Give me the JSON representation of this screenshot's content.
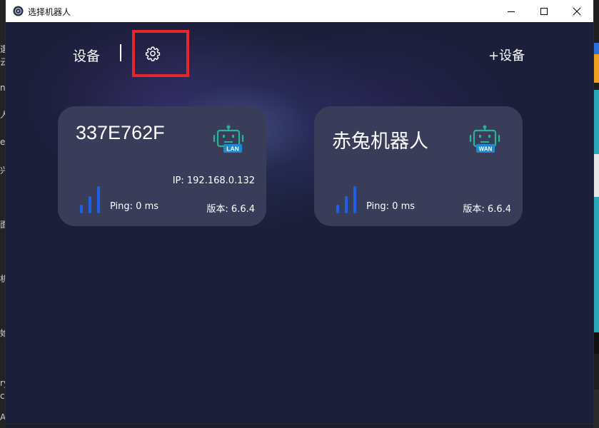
{
  "window": {
    "title": "选择机器人",
    "controls": {
      "minimize_icon": "minimize-icon",
      "maximize_icon": "maximize-icon",
      "close_icon": "close-icon"
    }
  },
  "header": {
    "devices_label": "设备",
    "settings_icon": "gear-icon",
    "add_device_label": "+设备"
  },
  "devices": [
    {
      "name": "337E762F",
      "connection_badge": "LAN",
      "ip": "IP: 192.168.0.132",
      "ping": "Ping: 0 ms",
      "version": "版本: 6.6.4",
      "icon": "robot-icon",
      "signal_icon": "signal-strength-icon"
    },
    {
      "name": "赤兔机器人",
      "connection_badge": "WAN",
      "ip": "",
      "ping": "Ping: 0 ms",
      "version": "版本: 6.6.4",
      "icon": "robot-icon",
      "signal_icon": "signal-strength-icon"
    }
  ],
  "colors": {
    "background": "#1b1f3a",
    "card": "#3a3d59",
    "robot_green": "#2bb39a",
    "badge_blue": "#1e88d0",
    "signal_blue": "#1d5fe6",
    "highlight_red": "#e5262d"
  }
}
